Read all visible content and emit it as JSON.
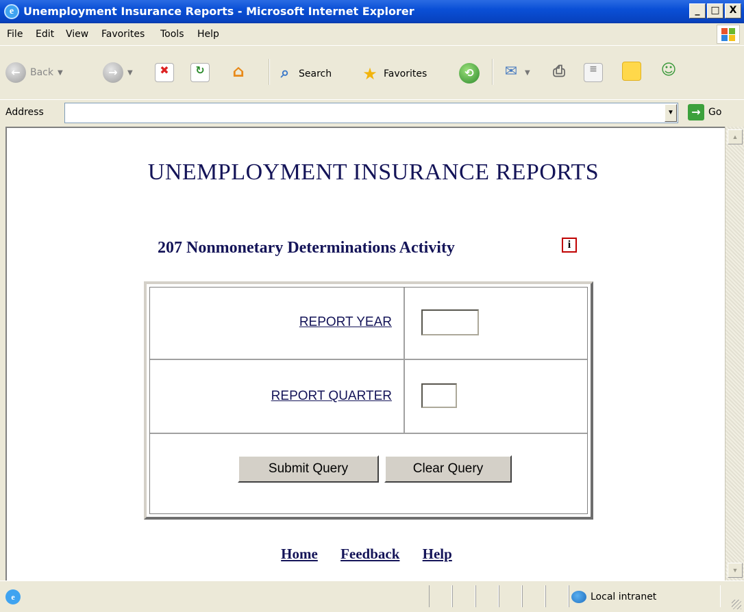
{
  "window": {
    "title": "Unemployment Insurance Reports - Microsoft Internet Explorer",
    "minimize": "_",
    "maximize": "□",
    "close": "X"
  },
  "menu": [
    "File",
    "Edit",
    "View",
    "Favorites",
    "Tools",
    "Help"
  ],
  "toolbar": {
    "back_label": "Back",
    "search_label": "Search",
    "favorites_label": "Favorites"
  },
  "address": {
    "label": "Address",
    "value": "",
    "go_label": "Go"
  },
  "page": {
    "title": "UNEMPLOYMENT INSURANCE REPORTS",
    "subtitle": "207 Nonmonetary Determinations Activity",
    "info_glyph": "i",
    "form": {
      "report_year_label": "REPORT YEAR",
      "report_year_value": "",
      "report_quarter_label": "REPORT QUARTER",
      "report_quarter_value": "",
      "submit_label": "Submit Query",
      "clear_label": "Clear Query"
    },
    "footer_links": [
      "Home",
      "Feedback",
      "Help"
    ]
  },
  "status": {
    "zone": "Local intranet"
  },
  "colors": {
    "heading": "#141458",
    "titlebar": "#0A4FD6",
    "chrome": "#ECE9D8"
  }
}
